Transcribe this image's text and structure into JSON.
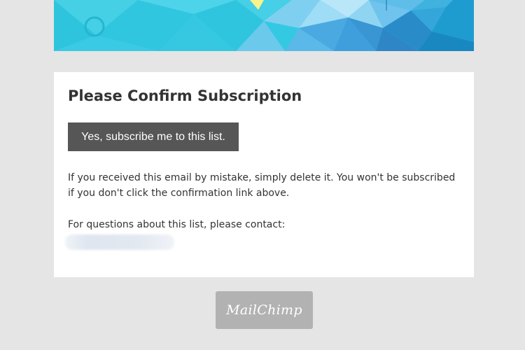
{
  "email": {
    "title": "Please Confirm Subscription",
    "confirm_button_label": "Yes, subscribe me to this list.",
    "body_text": "If you received this email by mistake, simply delete it. You won't be subscribed if you don't click the confirmation link above.",
    "contact_label": "For questions about this list, please contact:"
  },
  "footer": {
    "logo_text": "MailChimp"
  },
  "colors": {
    "page_background": "#e5e5e5",
    "card_background": "#ffffff",
    "button_background": "#565656",
    "footer_badge": "#b2b2b2",
    "banner_accent": "#2bc6de"
  }
}
